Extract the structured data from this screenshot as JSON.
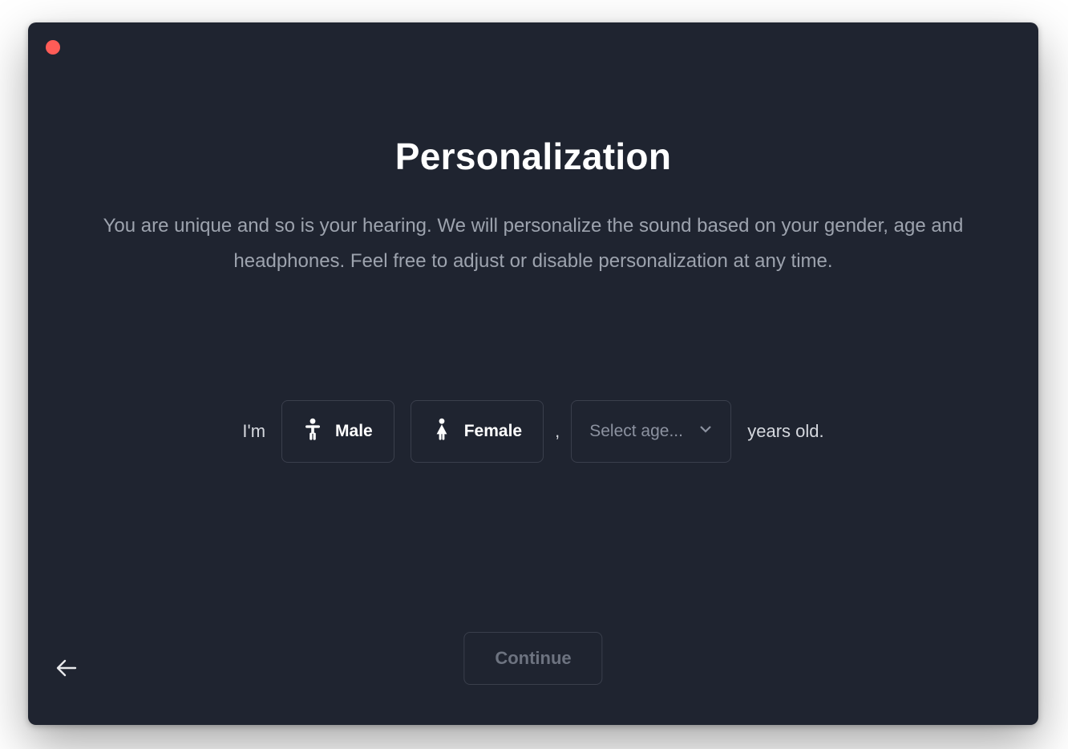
{
  "colors": {
    "window_bg": "#1f2430",
    "close_button": "#ff5c57",
    "border": "#3a3f4c",
    "text_muted": "#9da3ae",
    "text_light": "#d5d8de",
    "text_white": "#ffffff",
    "text_disabled": "#6d7380"
  },
  "header": {
    "title": "Personalization",
    "description": "You are unique and so is your hearing. We will personalize the sound based on your gender, age and headphones. Feel free to adjust or disable personalization at any time."
  },
  "form": {
    "prefix": "I'm",
    "gender_options": {
      "male": "Male",
      "female": "Female"
    },
    "comma": ",",
    "age_select_placeholder": "Select age...",
    "suffix": "years old."
  },
  "footer": {
    "continue_label": "Continue"
  },
  "icons": {
    "male": "male-icon",
    "female": "female-icon",
    "chevron_down": "chevron-down-icon",
    "back": "arrow-left-icon"
  }
}
